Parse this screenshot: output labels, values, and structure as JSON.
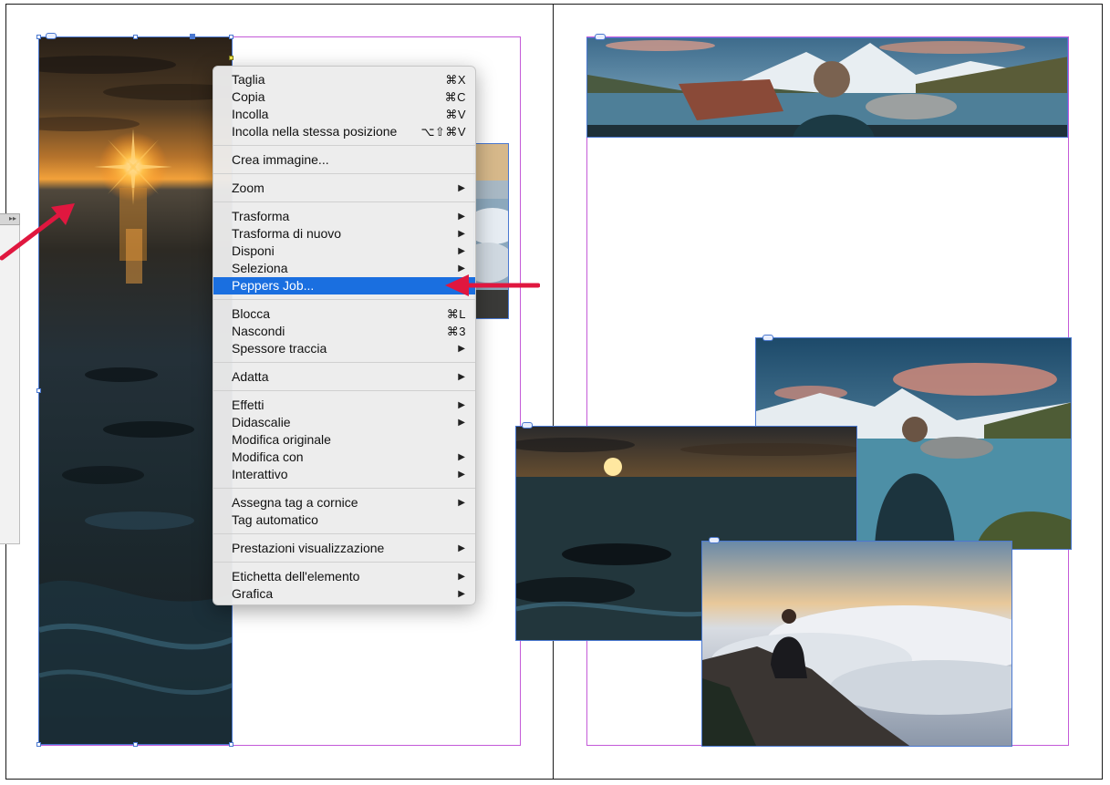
{
  "panel": {
    "collapse_glyph": "▸▸"
  },
  "menu": {
    "groups": [
      [
        {
          "label": "Taglia",
          "shortcut": "⌘X"
        },
        {
          "label": "Copia",
          "shortcut": "⌘C"
        },
        {
          "label": "Incolla",
          "shortcut": "⌘V"
        },
        {
          "label": "Incolla nella stessa posizione",
          "shortcut": "⌥⇧⌘V"
        }
      ],
      [
        {
          "label": "Crea immagine..."
        }
      ],
      [
        {
          "label": "Zoom",
          "submenu": true
        }
      ],
      [
        {
          "label": "Trasforma",
          "submenu": true
        },
        {
          "label": "Trasforma di nuovo",
          "submenu": true
        },
        {
          "label": "Disponi",
          "submenu": true
        },
        {
          "label": "Seleziona",
          "submenu": true
        },
        {
          "label": "Peppers Job...",
          "highlighted": true
        }
      ],
      [
        {
          "label": "Blocca",
          "shortcut": "⌘L"
        },
        {
          "label": "Nascondi",
          "shortcut": "⌘3"
        },
        {
          "label": "Spessore traccia",
          "submenu": true
        }
      ],
      [
        {
          "label": "Adatta",
          "submenu": true
        }
      ],
      [
        {
          "label": "Effetti",
          "submenu": true
        },
        {
          "label": "Didascalie",
          "submenu": true
        },
        {
          "label": "Modifica originale"
        },
        {
          "label": "Modifica con",
          "submenu": true
        },
        {
          "label": "Interattivo",
          "submenu": true
        }
      ],
      [
        {
          "label": "Assegna tag a cornice",
          "submenu": true
        },
        {
          "label": "Tag automatico"
        }
      ],
      [
        {
          "label": "Prestazioni visualizzazione",
          "submenu": true
        }
      ],
      [
        {
          "label": "Etichetta dell'elemento",
          "submenu": true
        },
        {
          "label": "Grafica",
          "submenu": true
        }
      ]
    ]
  },
  "colors": {
    "highlight": "#1a6fe0",
    "annotation_arrow": "#e0173f",
    "frame_stroke": "#4a78d0",
    "margin_guide": "#c45ad8"
  }
}
